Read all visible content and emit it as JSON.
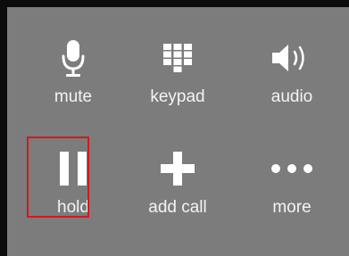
{
  "call_controls": [
    {
      "id": "mute",
      "label": "mute",
      "icon": "microphone-icon"
    },
    {
      "id": "keypad",
      "label": "keypad",
      "icon": "keypad-grid-icon"
    },
    {
      "id": "audio",
      "label": "audio",
      "icon": "speaker-icon"
    },
    {
      "id": "hold",
      "label": "hold",
      "icon": "pause-icon"
    },
    {
      "id": "add_call",
      "label": "add call",
      "icon": "plus-icon"
    },
    {
      "id": "more",
      "label": "more",
      "icon": "ellipsis-icon"
    }
  ],
  "highlight": {
    "target": "hold",
    "color": "#d11a1a"
  },
  "colors": {
    "panel_background": "#7c7c7c",
    "outer_background": "#0c0c0c",
    "foreground": "#ffffff"
  }
}
